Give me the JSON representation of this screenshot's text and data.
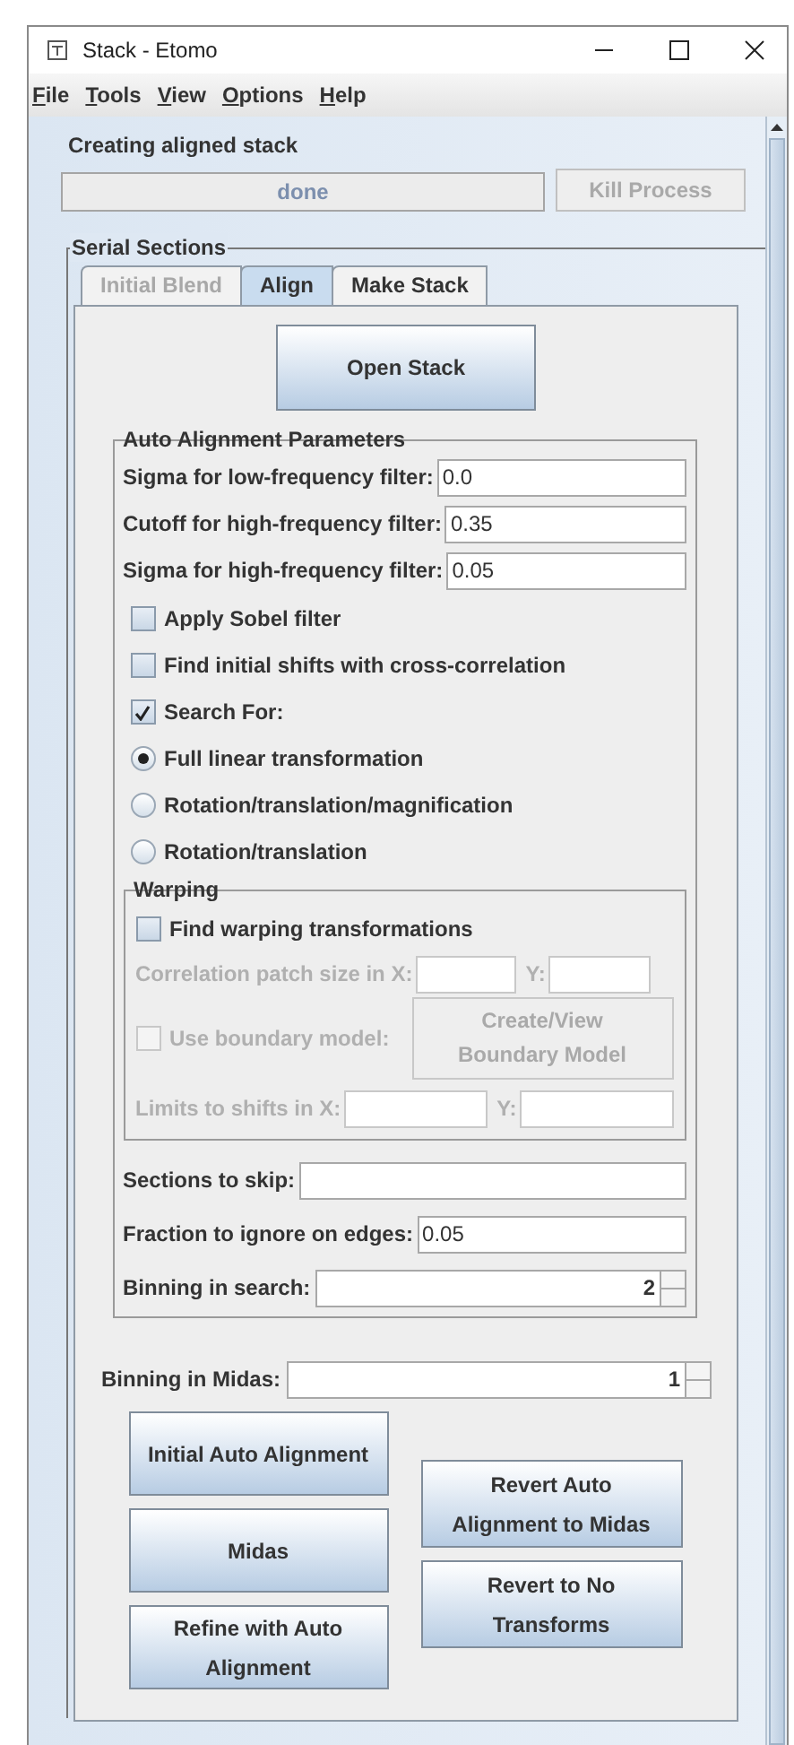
{
  "window": {
    "title": "Stack - Etomo"
  },
  "menu": [
    {
      "label": "File"
    },
    {
      "label": "Tools"
    },
    {
      "label": "View"
    },
    {
      "label": "Options"
    },
    {
      "label": "Help"
    }
  ],
  "process": {
    "title": "Creating aligned stack",
    "status": "done",
    "kill_button": {
      "label": "Kill Process",
      "disabled": true
    }
  },
  "serial_sections": {
    "title": "Serial Sections",
    "tabs": [
      {
        "label": "Initial Blend",
        "selected": false,
        "disabled": true
      },
      {
        "label": "Align",
        "selected": true,
        "disabled": false
      },
      {
        "label": "Make Stack",
        "selected": false,
        "disabled": false
      }
    ],
    "open_stack_button": "Open Stack",
    "auto_alignment": {
      "title": "Auto Alignment Parameters",
      "fields": [
        {
          "label": "Sigma for low-frequency filter:",
          "value": "0.0"
        },
        {
          "label": "Cutoff for high-frequency filter:",
          "value": "0.35"
        },
        {
          "label": "Sigma for high-frequency filter:",
          "value": "0.05"
        }
      ],
      "options": [
        {
          "kind": "checkbox",
          "label": "Apply Sobel filter",
          "checked": false
        },
        {
          "kind": "checkbox",
          "label": "Find initial shifts with cross-correlation",
          "checked": false
        },
        {
          "kind": "checkbox",
          "label": "Search For:",
          "checked": true
        },
        {
          "kind": "radio",
          "label": "Full linear transformation",
          "selected": true
        },
        {
          "kind": "radio",
          "label": "Rotation/translation/magnification",
          "selected": false
        },
        {
          "kind": "radio",
          "label": "Rotation/translation",
          "selected": false
        }
      ],
      "warping": {
        "title": "Warping",
        "find_checkbox": {
          "label": "Find warping transformations",
          "checked": false
        },
        "patch_size": {
          "label": "Correlation patch size in X:",
          "y_label": "Y:",
          "disabled": true
        },
        "boundary": {
          "label": "Use boundary model:",
          "checked": false,
          "disabled": true,
          "button": "Create/View Boundary Model"
        },
        "limits": {
          "label": "Limits to shifts in X:",
          "y_label": "Y:",
          "disabled": true
        }
      },
      "fields_after": [
        {
          "label": "Sections to skip:"
        },
        {
          "label": "Fraction to ignore on edges:",
          "value": "0.05"
        }
      ],
      "binning": {
        "label": "Binning in search:",
        "value": "2"
      }
    },
    "binning_midas": {
      "label": "Binning in Midas:",
      "value": "1"
    },
    "buttons_left": [
      "Initial Auto Alignment",
      "Midas",
      "Refine with Auto Alignment"
    ],
    "buttons_right": [
      "Revert Auto Alignment to Midas",
      "Revert to No Transforms"
    ]
  }
}
